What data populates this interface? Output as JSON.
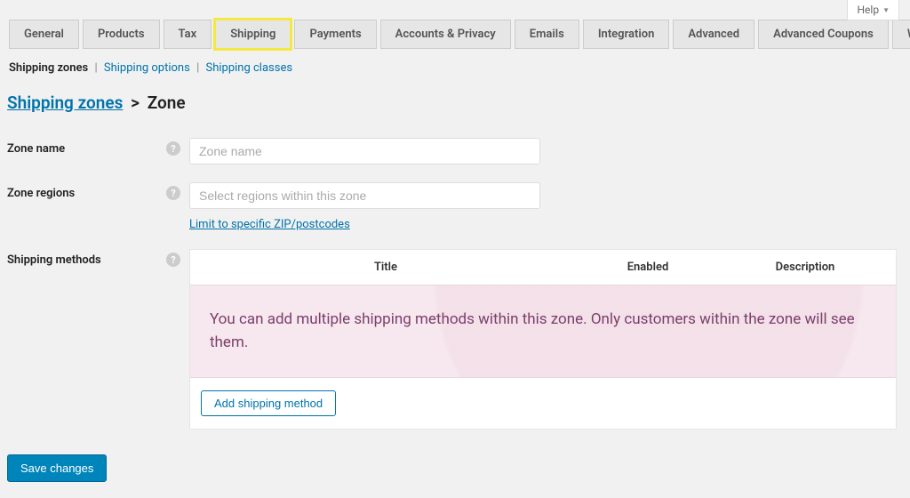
{
  "help": {
    "label": "Help"
  },
  "tabs": [
    {
      "label": "General"
    },
    {
      "label": "Products"
    },
    {
      "label": "Tax"
    },
    {
      "label": "Shipping",
      "active": true
    },
    {
      "label": "Payments"
    },
    {
      "label": "Accounts & Privacy"
    },
    {
      "label": "Emails"
    },
    {
      "label": "Integration"
    },
    {
      "label": "Advanced"
    },
    {
      "label": "Advanced Coupons"
    },
    {
      "label": "Wholesale Prices"
    }
  ],
  "subtabs": {
    "zones": "Shipping zones",
    "options": "Shipping options",
    "classes": "Shipping classes"
  },
  "breadcrumb": {
    "parent": "Shipping zones",
    "current": "Zone"
  },
  "fields": {
    "zone_name": {
      "label": "Zone name",
      "placeholder": "Zone name",
      "value": ""
    },
    "zone_regions": {
      "label": "Zone regions",
      "placeholder": "Select regions within this zone",
      "zip_link": "Limit to specific ZIP/postcodes"
    },
    "methods": {
      "label": "Shipping methods",
      "cols": {
        "title": "Title",
        "enabled": "Enabled",
        "description": "Description"
      },
      "empty_text": "You can add multiple shipping methods within this zone. Only customers within the zone will see them.",
      "add_button": "Add shipping method"
    }
  },
  "save_label": "Save changes"
}
